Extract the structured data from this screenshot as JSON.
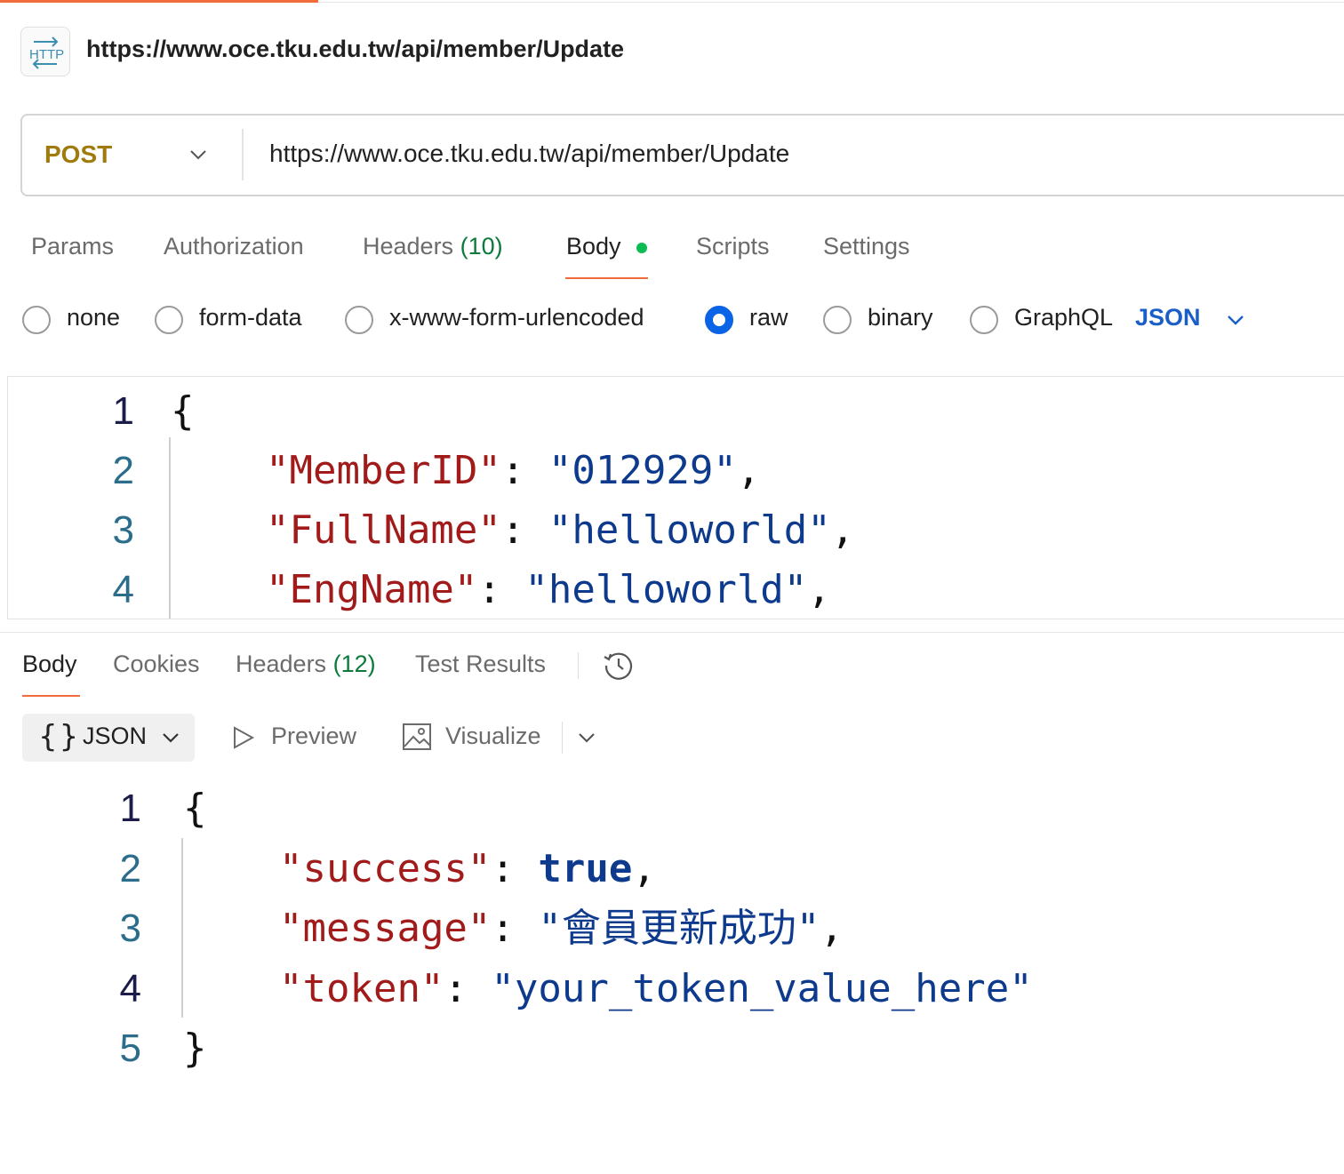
{
  "request": {
    "title": "https://www.oce.tku.edu.tw/api/member/Update",
    "http_icon_text": "HTTP",
    "method": "POST",
    "url": "https://www.oce.tku.edu.tw/api/member/Update"
  },
  "request_tabs": {
    "params": "Params",
    "authorization": "Authorization",
    "headers_label": "Headers",
    "headers_count": "(10)",
    "body": "Body",
    "scripts": "Scripts",
    "settings": "Settings",
    "active": "Body"
  },
  "body_types": {
    "options": [
      "none",
      "form-data",
      "x-www-form-urlencoded",
      "raw",
      "binary",
      "GraphQL"
    ],
    "selected": "raw",
    "format": "JSON"
  },
  "request_body": {
    "line_numbers": [
      "1",
      "2",
      "3",
      "4"
    ],
    "open_brace": "{",
    "lines": [
      {
        "key": "\"MemberID\"",
        "sep": ": ",
        "value": "\"012929\"",
        "end": ","
      },
      {
        "key": "\"FullName\"",
        "sep": ": ",
        "value": "\"helloworld\"",
        "end": ","
      },
      {
        "key": "\"EngName\"",
        "sep": ": ",
        "value": "\"helloworld\"",
        "end": ","
      }
    ]
  },
  "response_tabs": {
    "body": "Body",
    "cookies": "Cookies",
    "headers_label": "Headers",
    "headers_count": "(12)",
    "test_results": "Test Results",
    "active": "Body"
  },
  "response_toolbar": {
    "format_braces": "{}",
    "format": "JSON",
    "preview": "Preview",
    "visualize": "Visualize"
  },
  "response_body": {
    "line_numbers": [
      "1",
      "2",
      "3",
      "4",
      "5"
    ],
    "open_brace": "{",
    "close_brace": "}",
    "lines": [
      {
        "key": "\"success\"",
        "sep": ": ",
        "value": "true",
        "end": ","
      },
      {
        "key": "\"message\"",
        "sep": ": ",
        "value": "\"會員更新成功\"",
        "end": ","
      },
      {
        "key": "\"token\"",
        "sep": ": ",
        "value": "\"your_token_value_here\"",
        "end": ""
      }
    ]
  },
  "colors": {
    "accent": "#f26b3a",
    "method": "#a07a0c",
    "radio_selected": "#0b63e5",
    "json_key": "#a11b1b",
    "json_value": "#0d3a8c",
    "count": "#0b7a3b",
    "body_dot": "#0cbb52"
  },
  "icons": [
    "http-icon",
    "chevron-down-icon",
    "history-icon",
    "play-icon",
    "image-icon"
  ]
}
